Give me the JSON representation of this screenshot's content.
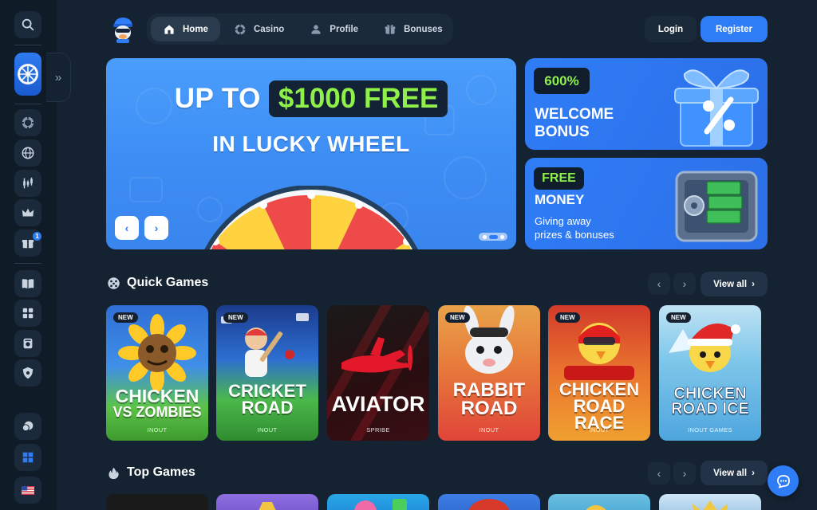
{
  "nav": {
    "items": [
      {
        "label": "Home",
        "icon": "home-icon"
      },
      {
        "label": "Casino",
        "icon": "poker-chip-icon"
      },
      {
        "label": "Profile",
        "icon": "user-icon"
      },
      {
        "label": "Bonuses",
        "icon": "gift-icon"
      }
    ],
    "login": "Login",
    "register": "Register"
  },
  "sidebar": {
    "icons": [
      "search-icon",
      "lucky-wheel-icon",
      "chip-icon",
      "globe-icon",
      "chart-icon",
      "crown-icon",
      "gift-icon",
      "book-icon",
      "puzzle-icon",
      "vault-icon",
      "shield-icon",
      "support-icon",
      "windows-icon",
      "us-flag-icon"
    ],
    "gift_badge": "1",
    "expand_glyph": "»"
  },
  "hero": {
    "line1_pre": "UP TO",
    "line1_highlight": "$1000 FREE",
    "line2": "IN LUCKY WHEEL",
    "prev": "‹",
    "next": "›"
  },
  "promos": [
    {
      "pill": "600%",
      "title_1": "WELCOME",
      "title_2": "BONUS"
    },
    {
      "pill": "FREE",
      "title": "MONEY",
      "sub_1": "Giving away",
      "sub_2": "prizes & bonuses"
    }
  ],
  "quick_games": {
    "title": "Quick Games",
    "view_all": "View all",
    "cards": [
      {
        "badge": "NEW",
        "name_1": "CHICKEN",
        "name_2": "VS ZOMBIES",
        "provider": "INOUT"
      },
      {
        "badge": "NEW",
        "name_1": "CRICKET",
        "name_2": "ROAD",
        "provider": "INOUT"
      },
      {
        "badge": "",
        "name_1": "AVIATOR",
        "name_2": "",
        "provider": "SPRIBE"
      },
      {
        "badge": "NEW",
        "name_1": "RABBIT",
        "name_2": "ROAD",
        "provider": "INOUT"
      },
      {
        "badge": "NEW",
        "name_1": "CHICKEN",
        "name_2": "ROAD RACE",
        "provider": "INOUT"
      },
      {
        "badge": "NEW",
        "name_1": "CHICKEN",
        "name_2": "ROAD ICE",
        "provider": "INOUT GAMES"
      }
    ]
  },
  "top_games": {
    "title": "Top Games",
    "view_all": "View all"
  },
  "colors": {
    "background": "#142231",
    "accent": "#2f7df6",
    "highlight_green": "#8ff04a"
  }
}
